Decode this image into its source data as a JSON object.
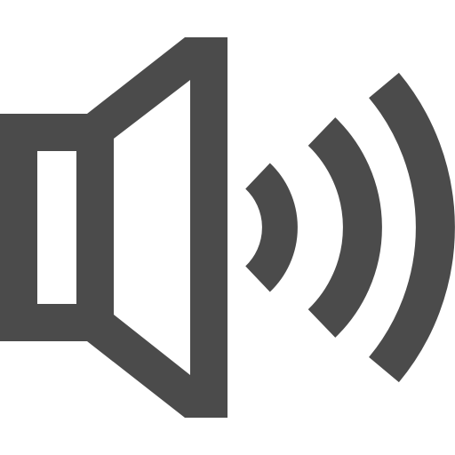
{
  "icon": {
    "name": "speaker-volume-icon",
    "color": "#4b4b4b",
    "background": "#ffffff",
    "sound_waves": 3
  }
}
